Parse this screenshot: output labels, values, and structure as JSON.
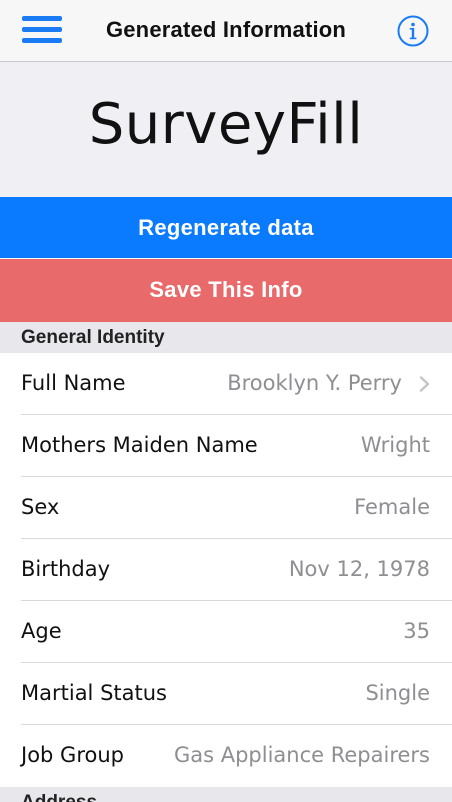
{
  "navbar": {
    "title": "Generated Information",
    "menu_icon": "hamburger-menu-icon",
    "info_icon": "info-circle-icon",
    "accent_color": "#1a7cf4"
  },
  "header": {
    "app_title": "SurveyFill"
  },
  "actions": {
    "regenerate_label": "Regenerate data",
    "save_label": "Save This Info",
    "regenerate_color": "#0a7bff",
    "save_color": "#e96a6a"
  },
  "sections": {
    "general_identity": {
      "title": "General Identity",
      "rows": [
        {
          "label": "Full Name",
          "value": "Brooklyn Y. Perry",
          "disclosure": true
        },
        {
          "label": "Mothers Maiden Name",
          "value": "Wright"
        },
        {
          "label": "Sex",
          "value": "Female"
        },
        {
          "label": "Birthday",
          "value": "Nov 12, 1978"
        },
        {
          "label": "Age",
          "value": "35"
        },
        {
          "label": "Martial Status",
          "value": "Single"
        },
        {
          "label": "Job Group",
          "value": "Gas Appliance Repairers"
        }
      ]
    },
    "address": {
      "title": "Address"
    }
  }
}
